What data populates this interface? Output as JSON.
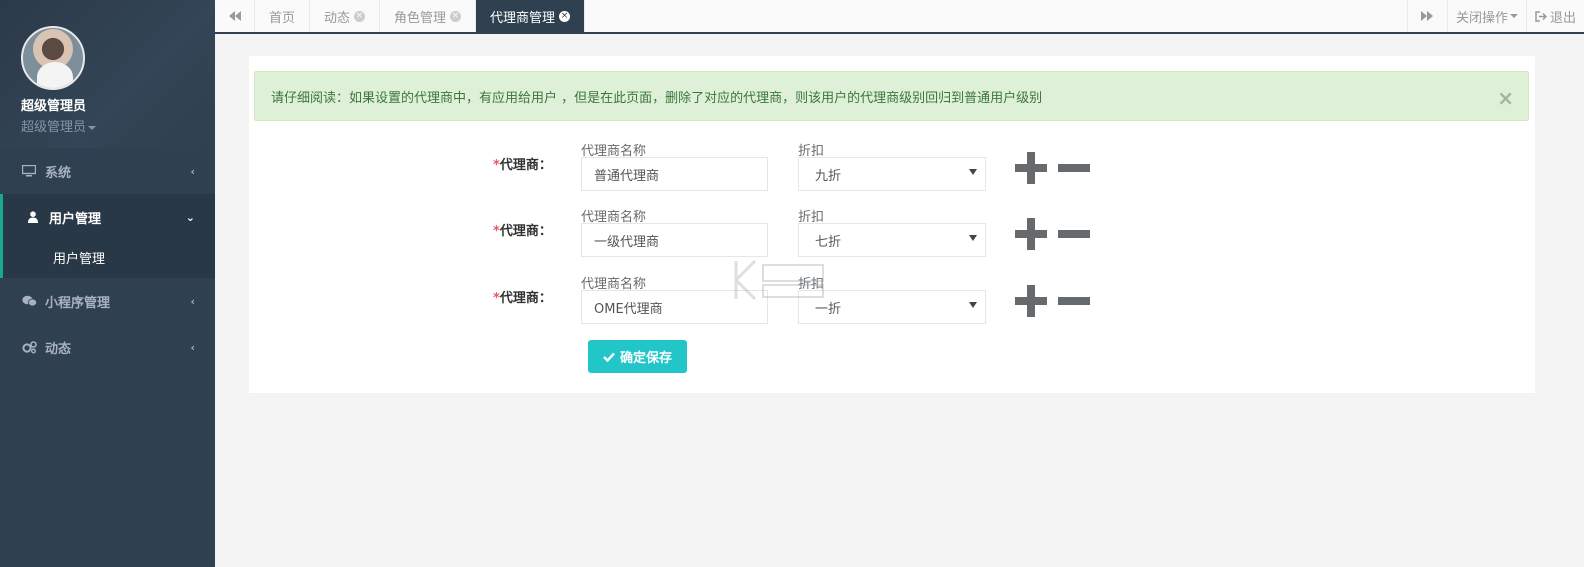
{
  "sidebar": {
    "profile": {
      "name": "超级管理员",
      "role": "超级管理员"
    },
    "items": [
      {
        "label": "系统",
        "icon": "monitor-icon"
      },
      {
        "label": "用户管理",
        "icon": "user-icon",
        "sub": "用户管理"
      },
      {
        "label": "小程序管理",
        "icon": "wechat-icon"
      },
      {
        "label": "动态",
        "icon": "gears-icon"
      }
    ]
  },
  "tabs": [
    {
      "label": "首页"
    },
    {
      "label": "动态"
    },
    {
      "label": "角色管理"
    },
    {
      "label": "代理商管理"
    }
  ],
  "topbar": {
    "close_ops": "关闭操作",
    "logout": "退出"
  },
  "alert": {
    "text": "请仔细阅读：如果设置的代理商中，有应用给用户 ，但是在此页面，删除了对应的代理商，则该用户的代理商级别回归到普通用户级别",
    "close": "×"
  },
  "form": {
    "required_mark": "*",
    "row_label": "代理商：",
    "name_caption": "代理商名称",
    "discount_caption": "折扣",
    "rows": [
      {
        "name": "普通代理商",
        "discount": "九折"
      },
      {
        "name": "一级代理商",
        "discount": "七折"
      },
      {
        "name": "OME代理商",
        "discount": "一折"
      }
    ],
    "save_label": "确定保存"
  },
  "colors": {
    "sidebar_bg": "#2f4050",
    "accent": "#19aa8d",
    "save_button": "#23c6c8",
    "alert_bg": "#dff0d8",
    "alert_text": "#3c763d"
  }
}
